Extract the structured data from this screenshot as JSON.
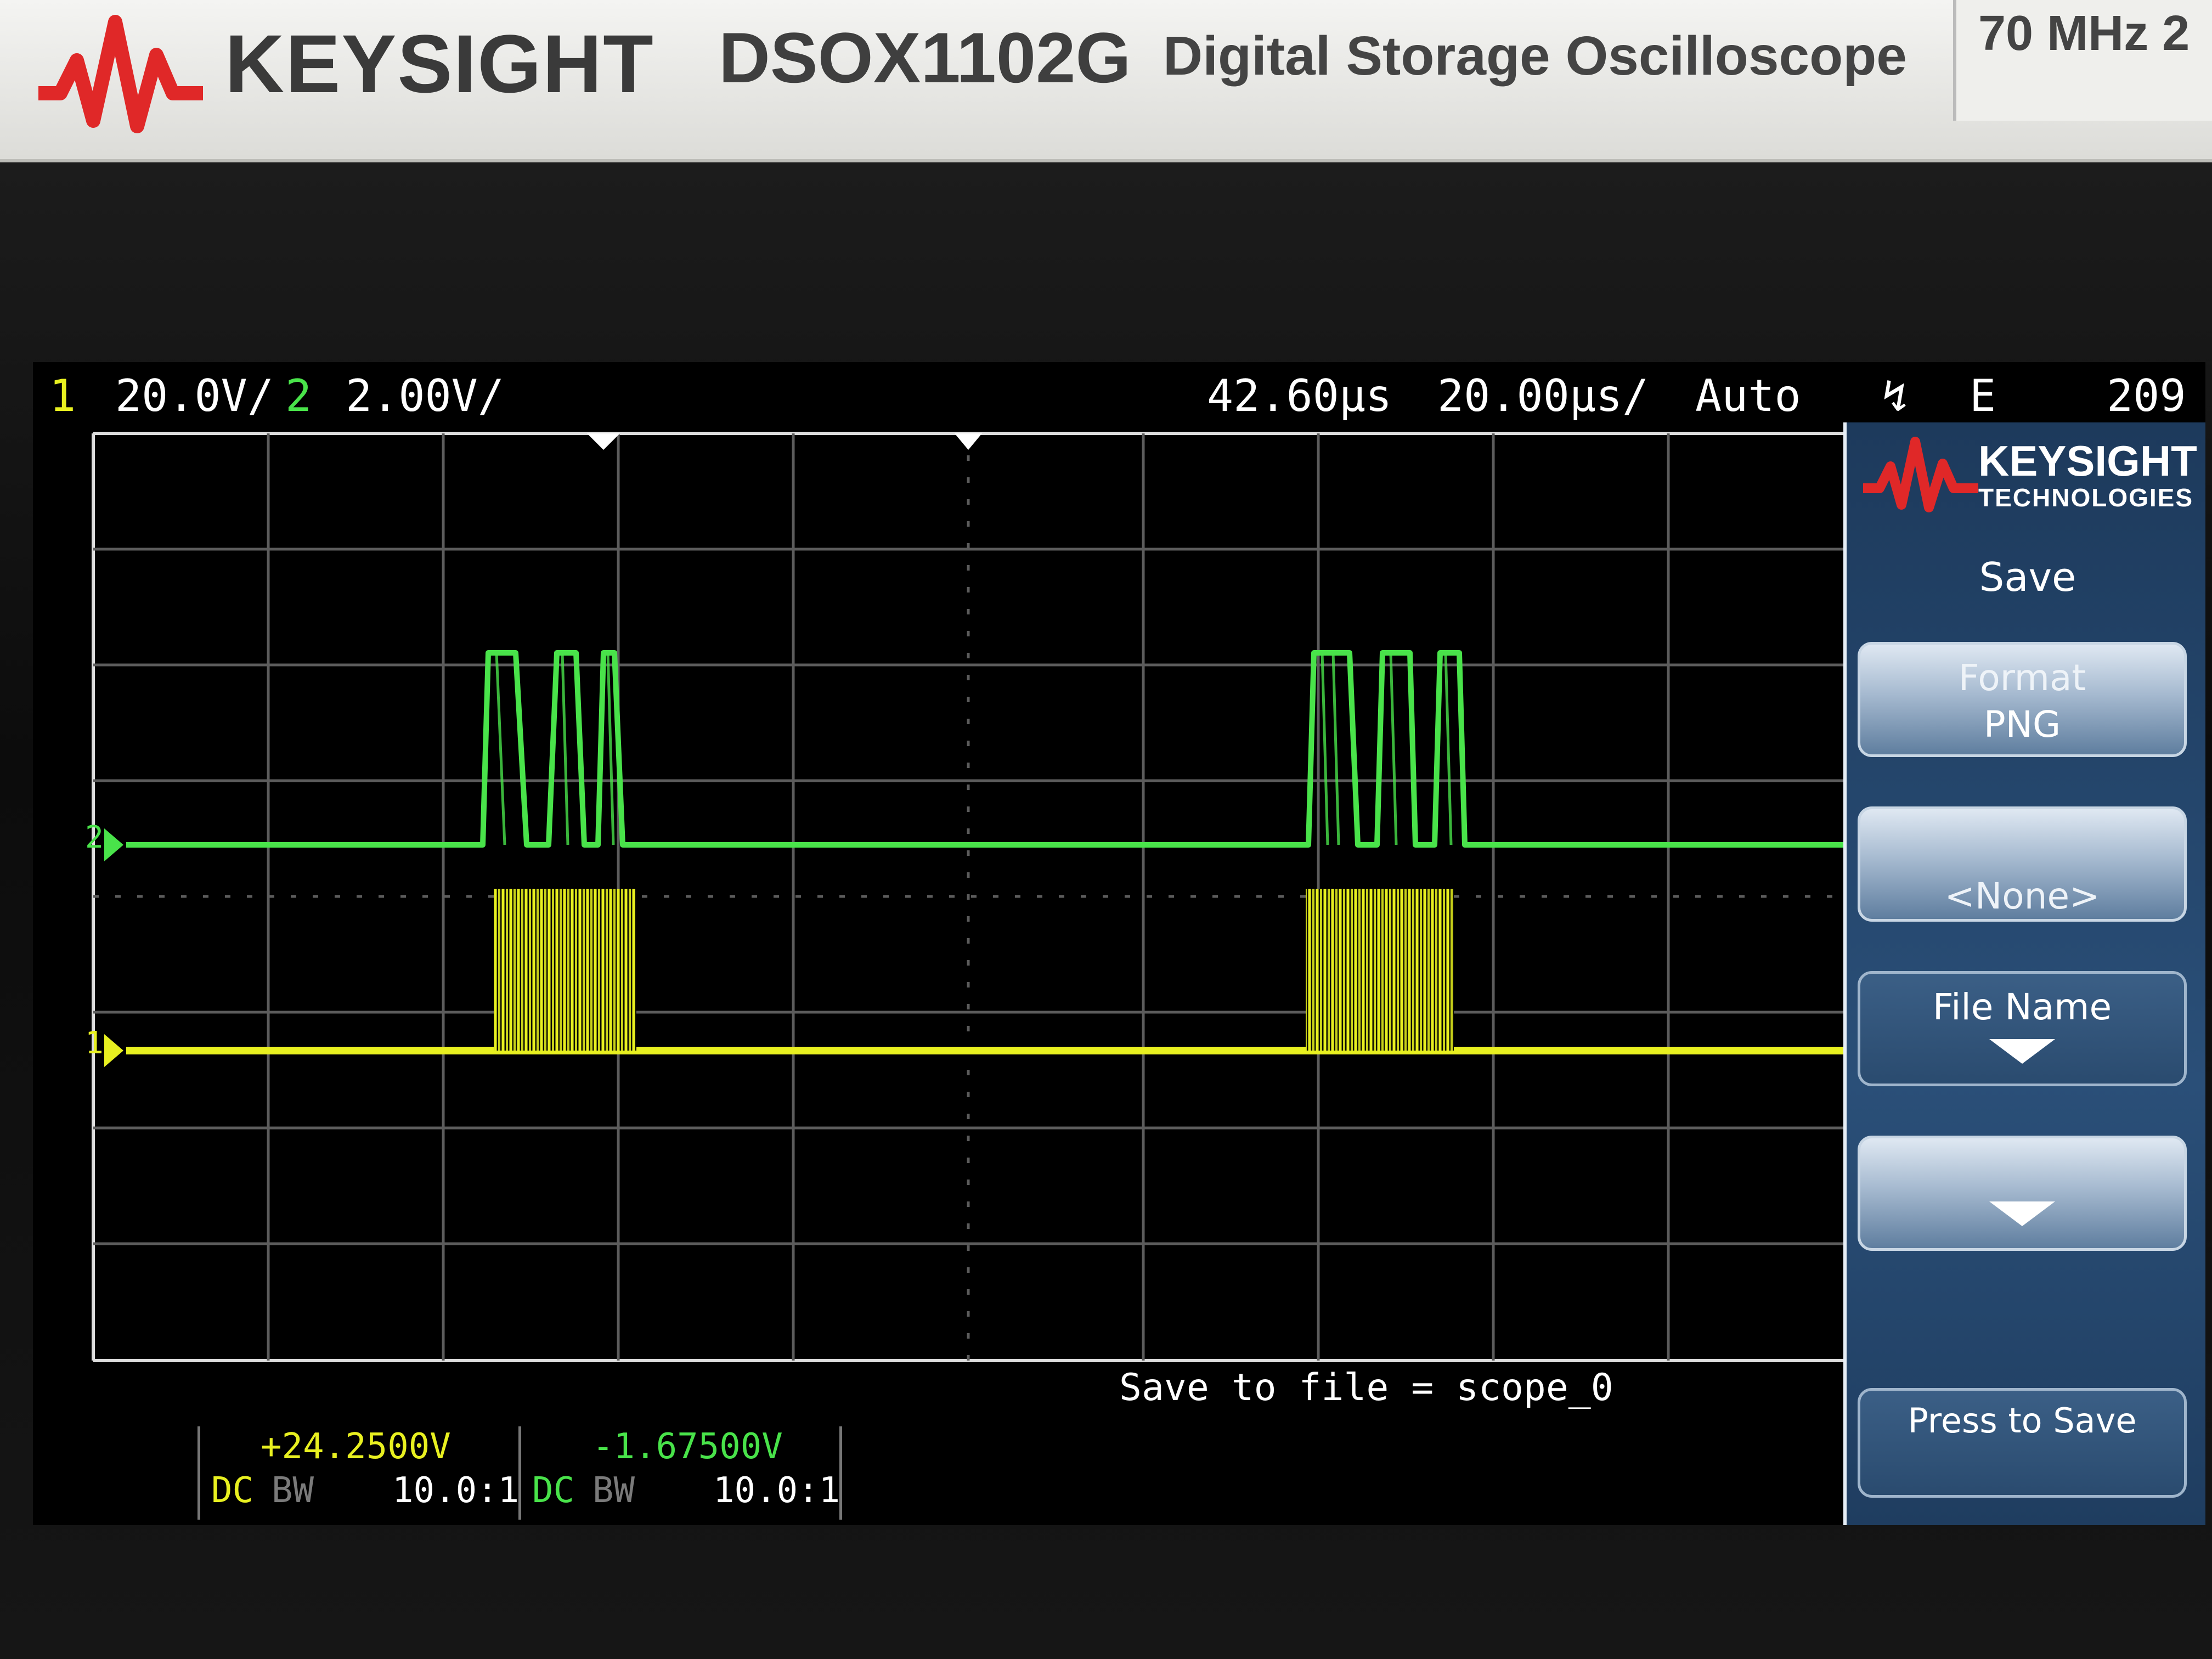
{
  "instrument": {
    "brand": "KEYSIGHT",
    "model": "DSOX1102G",
    "description": "Digital Storage Oscilloscope",
    "spec": "70 MHz  2"
  },
  "status": {
    "ch1_num": "1",
    "ch1_scale": "20.0V/",
    "ch2_num": "2",
    "ch2_scale": "2.00V/",
    "time_delay": "42.60µs",
    "time_scale": "20.00µs/",
    "trigger_mode": "Auto",
    "trigger_slope_symbol": "↯",
    "trigger_source": "E",
    "trigger_level": "209"
  },
  "softkeys": {
    "brand": "KEYSIGHT",
    "brand_sub": "TECHNOLOGIES",
    "title": "Save",
    "format_label": "Format",
    "format_value": "PNG",
    "location_value": "<None>",
    "filename_label": "File Name",
    "press_to_save": "Press to Save"
  },
  "bottom": {
    "save_to_file": "Save to file = scope_0",
    "ch1_offset": "+24.2500V",
    "ch1_coupling": "DC",
    "ch1_bw": "BW",
    "ch1_probe": "10.0:1",
    "ch2_offset": "-1.67500V",
    "ch2_coupling": "DC",
    "ch2_bw": "BW",
    "ch2_probe": "10.0:1"
  },
  "markers": {
    "ch1_ground": "1",
    "ch2_ground": "2"
  },
  "colors": {
    "ch1": "#e8f020",
    "ch2": "#49e34a",
    "grid": "#5a5a5a",
    "softkey_panel": "#2a4f78"
  }
}
